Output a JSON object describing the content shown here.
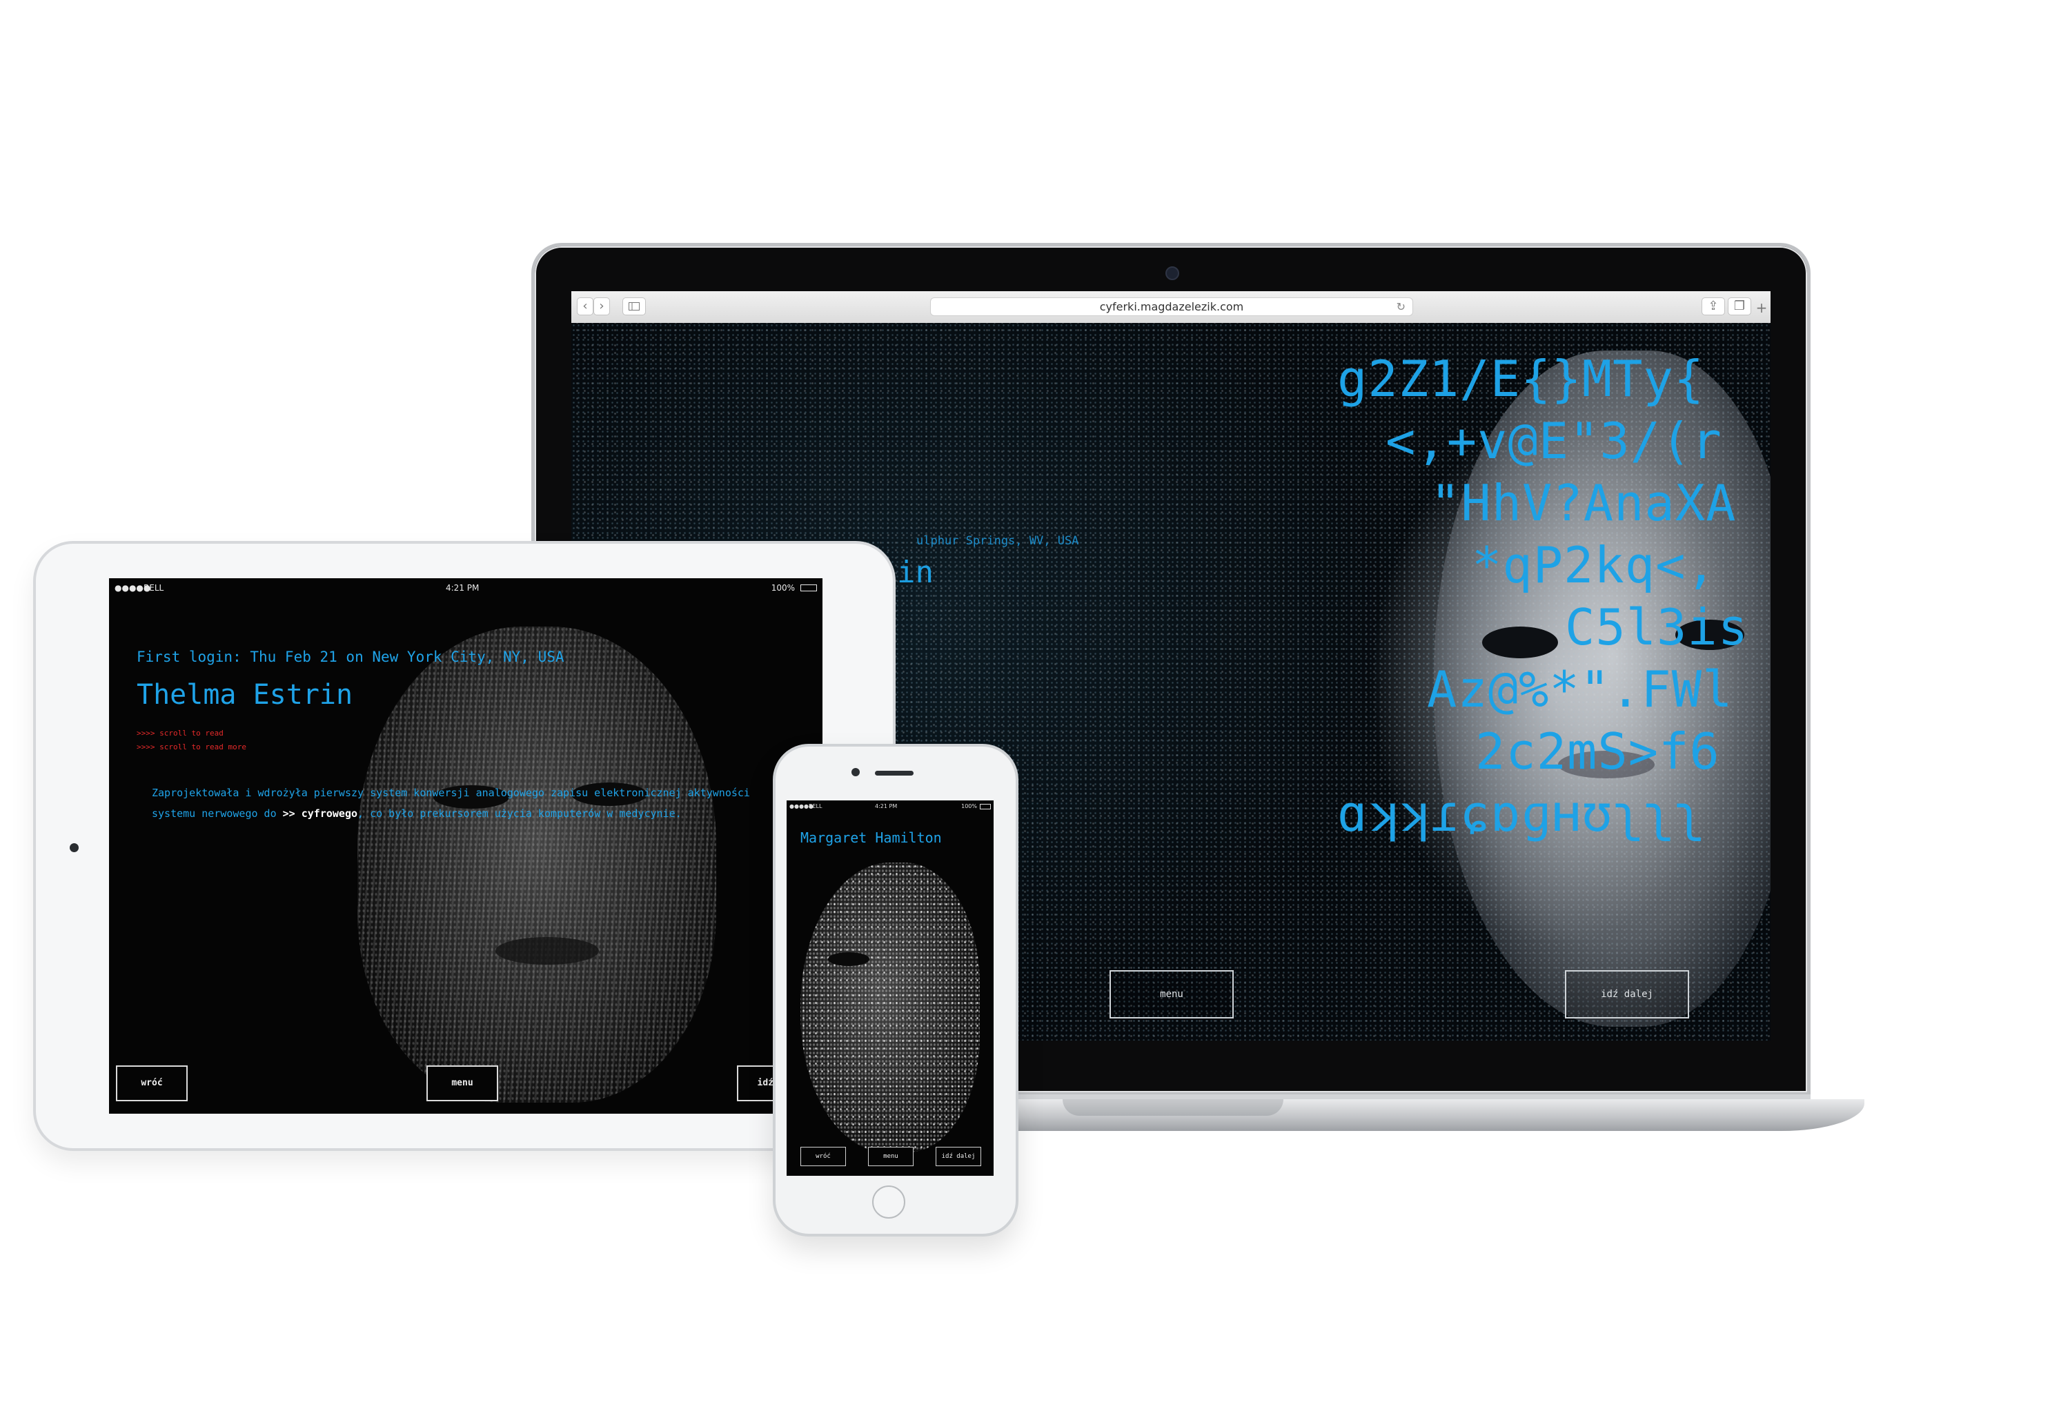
{
  "laptop": {
    "browser": {
      "url": "cyferki.magdazelezik.com",
      "back_icon": "chevron-left-icon",
      "forward_icon": "chevron-right-icon",
      "sidebar_icon": "sidebar-icon",
      "reload_icon": "reload-icon",
      "share_icon": "share-icon",
      "tabs_icon": "tabs-icon",
      "new_tab_icon": "plus-icon"
    },
    "page": {
      "subtitle_fragment": "ulphur Springs, WV, USA",
      "name_fragment": "in",
      "code_lines": [
        "g2Z1/E{}MTy{",
        "<,+v@E\"3/(r",
        "\"HhV?AnaXA",
        "*qP2kq<,",
        "C5l3is",
        "Az@%*\".FWl",
        "2c2mS>f6",
        "ɑʞʞɾɕɒɡʜʊʅʅʅ"
      ],
      "menu_label": "menu",
      "next_label": "idź dalej"
    }
  },
  "tablet": {
    "status": {
      "carrier": "BELL",
      "time": "4:21 PM",
      "battery": "100%"
    },
    "login_line": "First login: Thu Feb 21 on New York City, NY, USA",
    "name": "Thelma Estrin",
    "scroll_lines": [
      ">>>> scroll to read",
      ">>>> scroll to read more"
    ],
    "description": {
      "part1": "Zaprojektowała i wdrożyła pierwszy system konwersji analogowego zapisu elektronicznej aktywności systemu nerwowego do ",
      "highlight": ">> cyfrowego",
      "part2": ", co było prekursorem użycia komputerów w medycynie."
    },
    "back_label": "wróć",
    "menu_label": "menu",
    "next_label": "idź da"
  },
  "phone": {
    "status": {
      "carrier": "BELL",
      "time": "4:21 PM",
      "battery": "100%"
    },
    "name": "Margaret Hamilton",
    "back_label": "wróć",
    "menu_label": "menu",
    "next_label": "idź dalej"
  },
  "colors": {
    "accent_blue": "#1fa3e8",
    "warning_red": "#e52a2a",
    "screen_bg": "#050505"
  }
}
